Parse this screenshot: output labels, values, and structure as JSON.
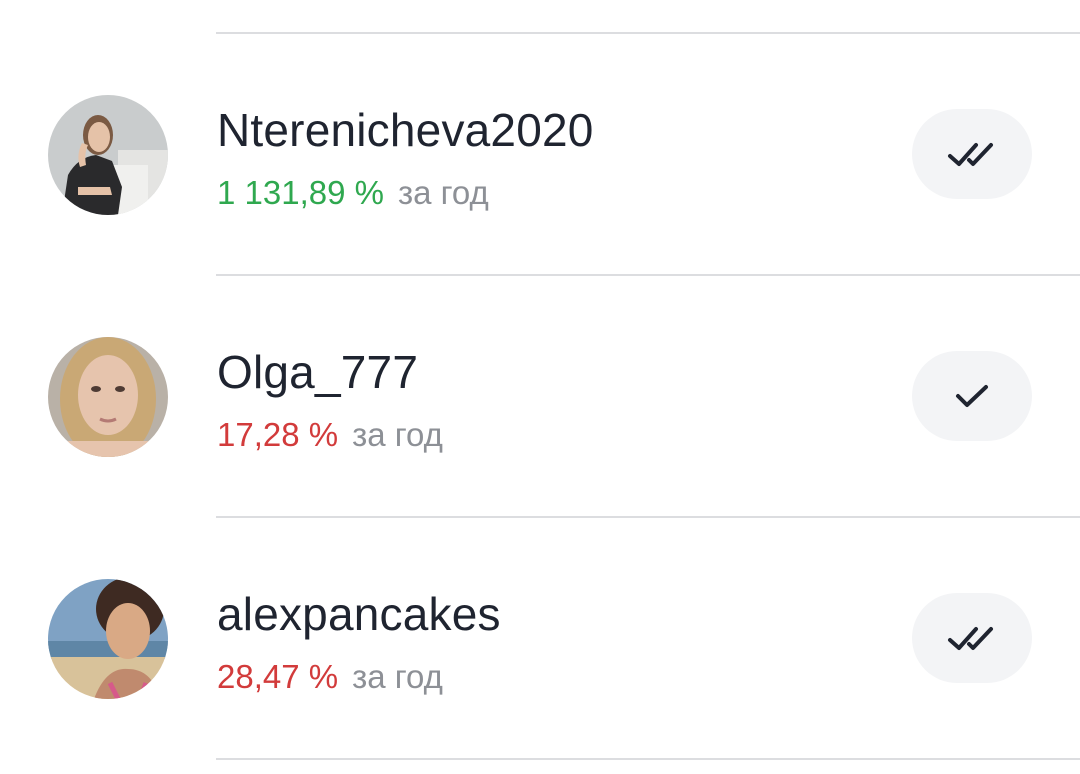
{
  "traders": [
    {
      "name": "Nterenicheva2020",
      "return": "1 131,89 %",
      "return_trend": "up",
      "period": "за год",
      "status_icon": "double-check-icon"
    },
    {
      "name": "Olga_777",
      "return": "17,28 %",
      "return_trend": "down",
      "period": "за год",
      "status_icon": "check-icon"
    },
    {
      "name": "alexpancakes",
      "return": "28,47 %",
      "return_trend": "down",
      "period": "за год",
      "status_icon": "double-check-icon"
    }
  ],
  "colors": {
    "positive": "#2fa84f",
    "negative": "#d23b3b",
    "muted": "#8d9096",
    "text": "#1f2430",
    "button_bg": "#f3f4f6"
  }
}
